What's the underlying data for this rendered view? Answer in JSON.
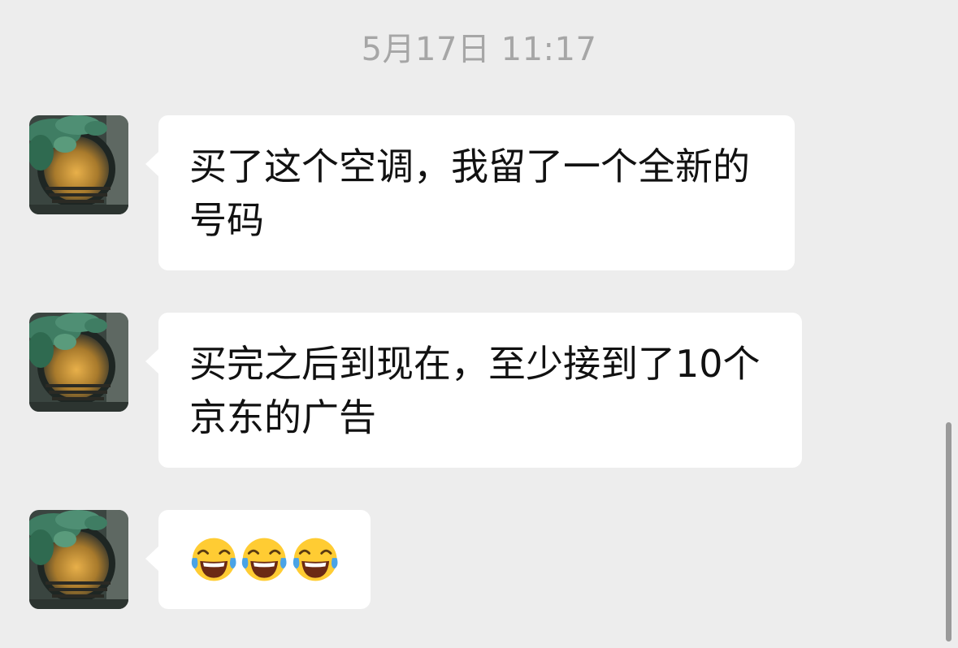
{
  "chat": {
    "timestamp": "5月17日 11:17",
    "messages": [
      {
        "sender": "contact",
        "avatar_icon": "avatar-moon-gate-garden",
        "text": "买了这个空调，我留了一个全新的号码"
      },
      {
        "sender": "contact",
        "avatar_icon": "avatar-moon-gate-garden",
        "text": "买完之后到现在，至少接到了10个京东的广告"
      },
      {
        "sender": "contact",
        "avatar_icon": "avatar-moon-gate-garden",
        "emojis": [
          "face-with-tears-of-joy",
          "face-with-tears-of-joy",
          "face-with-tears-of-joy"
        ]
      }
    ]
  },
  "colors": {
    "background": "#ededed",
    "bubble": "#ffffff",
    "timestamp_text": "#a6a6a6",
    "message_text": "#111111",
    "scrollbar": "#9a9a9a"
  }
}
